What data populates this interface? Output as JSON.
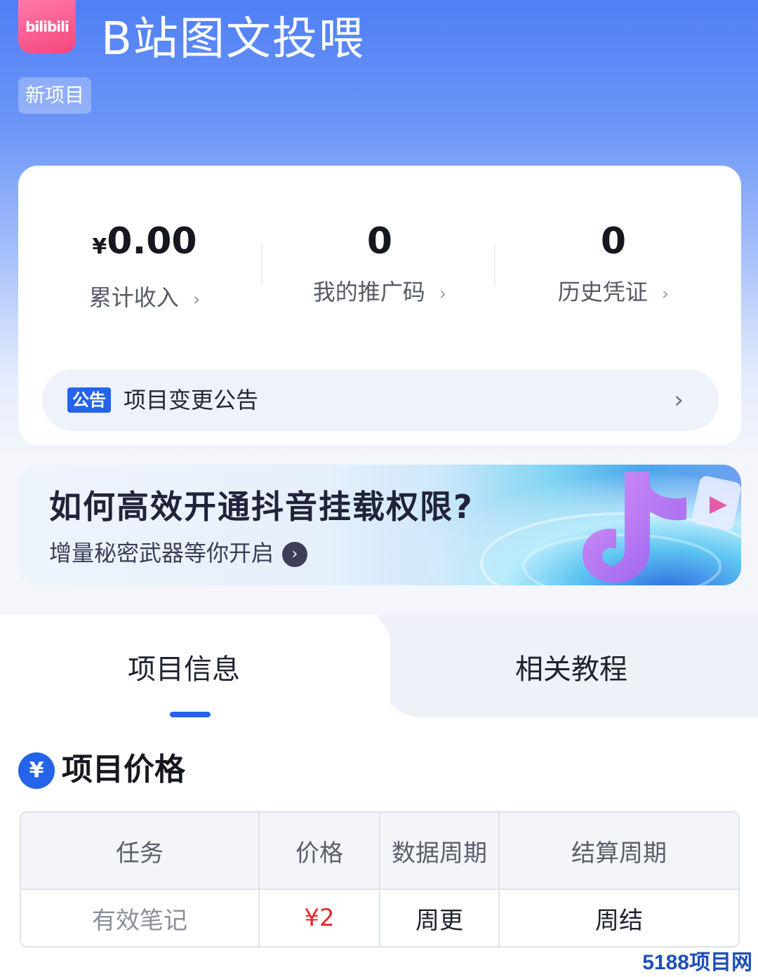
{
  "header": {
    "logo_text": "bilibili",
    "title": "B站图文投喂",
    "tag": "新项目"
  },
  "stats": [
    {
      "currency": "¥",
      "value": "0.00",
      "label": "累计收入",
      "chevron": "›"
    },
    {
      "currency": "",
      "value": "0",
      "label": "我的推广码",
      "chevron": "›"
    },
    {
      "currency": "",
      "value": "0",
      "label": "历史凭证",
      "chevron": "›"
    }
  ],
  "notice": {
    "badge": "公告",
    "text": "项目变更公告",
    "chevron": "›"
  },
  "banner": {
    "title": "如何高效开通抖音挂载权限?",
    "subtitle": "增量秘密武器等你开启",
    "arrow": "›"
  },
  "tabs": [
    {
      "label": "项目信息",
      "active": true
    },
    {
      "label": "相关教程",
      "active": false
    }
  ],
  "section": {
    "icon": "¥",
    "title": "项目价格"
  },
  "table": {
    "headers": [
      "任务",
      "价格",
      "数据周期",
      "结算周期"
    ],
    "rows": [
      [
        "有效笔记",
        "¥2",
        "周更",
        "周结"
      ]
    ]
  },
  "watermark": "5188项目网",
  "colors": {
    "accent": "#2563eb",
    "price": "#e5282d",
    "logo": "#f4467c"
  }
}
